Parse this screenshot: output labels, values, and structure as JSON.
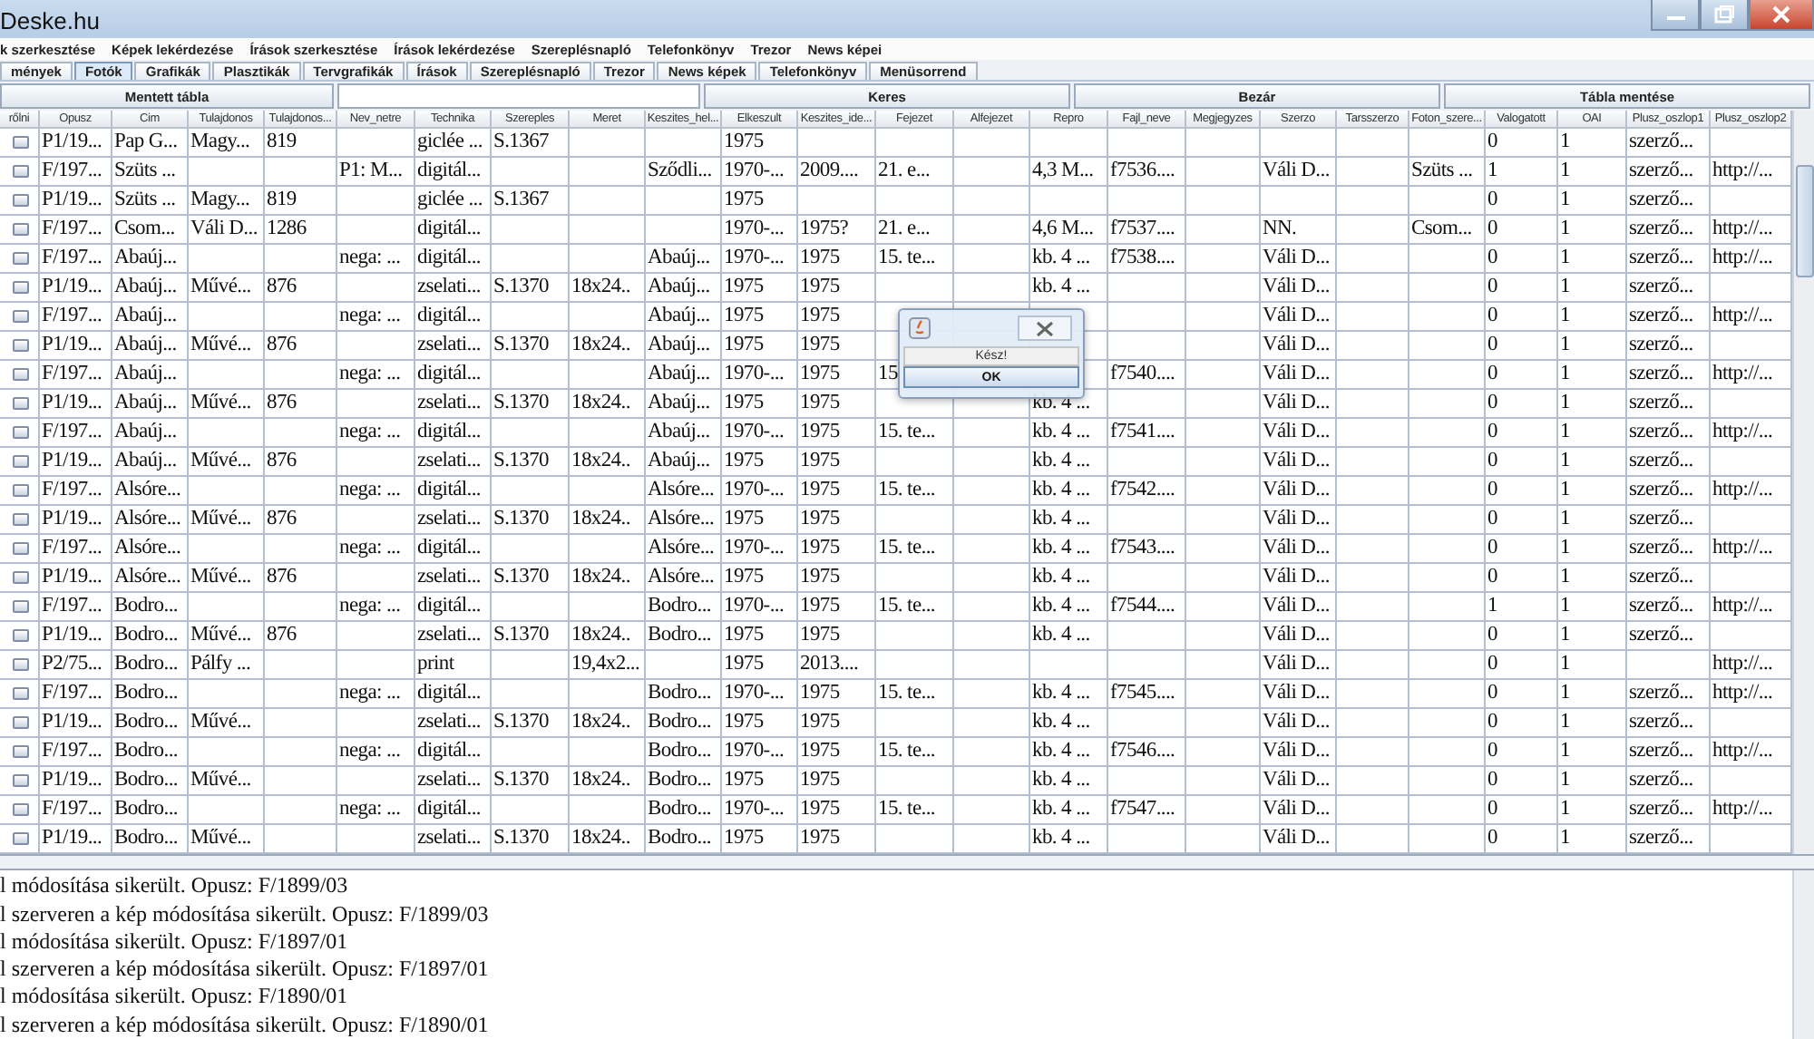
{
  "browser": {
    "title": "Deske.hu"
  },
  "menu": [
    "k szerkesztése",
    "Képek lekérdezése",
    "Írások szerkesztése",
    "Írások lekérdezése",
    "Szereplésnapló",
    "Telefonkönyv",
    "Trezor",
    "News képei"
  ],
  "tabs": [
    {
      "label": "mények",
      "selected": false
    },
    {
      "label": "Fotók",
      "selected": true
    },
    {
      "label": "Grafikák",
      "selected": false
    },
    {
      "label": "Plasztikák",
      "selected": false
    },
    {
      "label": "Tervgrafikák",
      "selected": false
    },
    {
      "label": "Írások",
      "selected": false
    },
    {
      "label": "Szereplésnapló",
      "selected": false
    },
    {
      "label": "Trezor",
      "selected": false
    },
    {
      "label": "News képek",
      "selected": false
    },
    {
      "label": "Telefonkönyv",
      "selected": false
    },
    {
      "label": "Menüsorrend",
      "selected": false
    }
  ],
  "toolbar": [
    {
      "kind": "button",
      "label": "Mentett tábla"
    },
    {
      "kind": "field"
    },
    {
      "kind": "button",
      "label": "Keres"
    },
    {
      "kind": "button",
      "label": "Bezár"
    },
    {
      "kind": "button",
      "label": "Tábla mentése"
    }
  ],
  "table": {
    "row_header_label": "rőlni",
    "columns": [
      "Opusz",
      "Cim",
      "Tulajdonos",
      "Tulajdonos...",
      "Nev_netre",
      "Technika",
      "Szereples",
      "Meret",
      "Keszites_hel...",
      "Elkeszult",
      "Keszites_ide...",
      "Fejezet",
      "Alfejezet",
      "Repro",
      "Fajl_neve",
      "Megjegyzes",
      "Szerzo",
      "Tarsszerzo",
      "Foton_szere...",
      "Valogatott",
      "OAI",
      "Plusz_oszlop1",
      "Plusz_oszlop2"
    ],
    "rows": [
      [
        "P1/19...",
        "Pap G...",
        "Magy...",
        "819",
        null,
        "giclée ...",
        "S.1367",
        null,
        null,
        "1975",
        null,
        null,
        null,
        null,
        null,
        null,
        null,
        null,
        null,
        "0",
        "1",
        "szerző...",
        null
      ],
      [
        "F/197...",
        "Szüts ...",
        null,
        null,
        "P1: M...",
        "digitál...",
        null,
        null,
        "Sződli...",
        "1970-...",
        "2009....",
        "21. e...",
        null,
        "4,3 M...",
        "f7536....",
        null,
        "Váli D...",
        null,
        "Szüts ...",
        "1",
        "1",
        "szerző...",
        "http://..."
      ],
      [
        "P1/19...",
        "Szüts ...",
        "Magy...",
        "819",
        null,
        "giclée ...",
        "S.1367",
        null,
        null,
        "1975",
        null,
        null,
        null,
        null,
        null,
        null,
        null,
        null,
        null,
        "0",
        "1",
        "szerző...",
        null
      ],
      [
        "F/197...",
        "Csom...",
        "Váli D...",
        "1286",
        null,
        "digitál...",
        null,
        null,
        null,
        "1970-...",
        "1975?",
        "21. e...",
        null,
        "4,6 M...",
        "f7537....",
        null,
        "NN.",
        null,
        "Csom...",
        "0",
        "1",
        "szerző...",
        "http://..."
      ],
      [
        "F/197...",
        "Abaúj...",
        null,
        null,
        "nega: ...",
        "digitál...",
        null,
        null,
        "Abaúj...",
        "1970-...",
        "1975",
        "15. te...",
        null,
        "kb. 4 ...",
        "f7538....",
        null,
        "Váli D...",
        null,
        null,
        "0",
        "1",
        "szerző...",
        "http://..."
      ],
      [
        "P1/19...",
        "Abaúj...",
        "Művé...",
        "876",
        null,
        "zselati...",
        "S.1370",
        "18x24..",
        "Abaúj...",
        "1975",
        "1975",
        null,
        null,
        "kb. 4 ...",
        null,
        null,
        "Váli D...",
        null,
        null,
        "0",
        "1",
        "szerző...",
        null
      ],
      [
        "F/197...",
        "Abaúj...",
        null,
        null,
        "nega: ...",
        "digitál...",
        null,
        null,
        "Abaúj...",
        "1975",
        "1975",
        null,
        null,
        null,
        null,
        null,
        "Váli D...",
        null,
        null,
        "0",
        "1",
        "szerző...",
        "http://..."
      ],
      [
        "P1/19...",
        "Abaúj...",
        "Művé...",
        "876",
        null,
        "zselati...",
        "S.1370",
        "18x24..",
        "Abaúj...",
        "1975",
        "1975",
        null,
        null,
        null,
        null,
        null,
        "Váli D...",
        null,
        null,
        "0",
        "1",
        "szerző...",
        null
      ],
      [
        "F/197...",
        "Abaúj...",
        null,
        null,
        "nega: ...",
        "digitál...",
        null,
        null,
        "Abaúj...",
        "1970-...",
        "1975",
        "15",
        null,
        null,
        "f7540....",
        null,
        "Váli D...",
        null,
        null,
        "0",
        "1",
        "szerző...",
        "http://..."
      ],
      [
        "P1/19...",
        "Abaúj...",
        "Művé...",
        "876",
        null,
        "zselati...",
        "S.1370",
        "18x24..",
        "Abaúj...",
        "1975",
        "1975",
        null,
        null,
        "kb. 4 ...",
        null,
        null,
        "Váli D...",
        null,
        null,
        "0",
        "1",
        "szerző...",
        null
      ],
      [
        "F/197...",
        "Abaúj...",
        null,
        null,
        "nega: ...",
        "digitál...",
        null,
        null,
        "Abaúj...",
        "1970-...",
        "1975",
        "15. te...",
        null,
        "kb. 4 ...",
        "f7541....",
        null,
        "Váli D...",
        null,
        null,
        "0",
        "1",
        "szerző...",
        "http://..."
      ],
      [
        "P1/19...",
        "Abaúj...",
        "Művé...",
        "876",
        null,
        "zselati...",
        "S.1370",
        "18x24..",
        "Abaúj...",
        "1975",
        "1975",
        null,
        null,
        "kb. 4 ...",
        null,
        null,
        "Váli D...",
        null,
        null,
        "0",
        "1",
        "szerző...",
        null
      ],
      [
        "F/197...",
        "Alsóre...",
        null,
        null,
        "nega: ...",
        "digitál...",
        null,
        null,
        "Alsóre...",
        "1970-...",
        "1975",
        "15. te...",
        null,
        "kb. 4 ...",
        "f7542....",
        null,
        "Váli D...",
        null,
        null,
        "0",
        "1",
        "szerző...",
        "http://..."
      ],
      [
        "P1/19...",
        "Alsóre...",
        "Művé...",
        "876",
        null,
        "zselati...",
        "S.1370",
        "18x24..",
        "Alsóre...",
        "1975",
        "1975",
        null,
        null,
        "kb. 4 ...",
        null,
        null,
        "Váli D...",
        null,
        null,
        "0",
        "1",
        "szerző...",
        null
      ],
      [
        "F/197...",
        "Alsóre...",
        null,
        null,
        "nega: ...",
        "digitál...",
        null,
        null,
        "Alsóre...",
        "1970-...",
        "1975",
        "15. te...",
        null,
        "kb. 4 ...",
        "f7543....",
        null,
        "Váli D...",
        null,
        null,
        "0",
        "1",
        "szerző...",
        "http://..."
      ],
      [
        "P1/19...",
        "Alsóre...",
        "Művé...",
        "876",
        null,
        "zselati...",
        "S.1370",
        "18x24..",
        "Alsóre...",
        "1975",
        "1975",
        null,
        null,
        "kb. 4 ...",
        null,
        null,
        "Váli D...",
        null,
        null,
        "0",
        "1",
        "szerző...",
        null
      ],
      [
        "F/197...",
        "Bodro...",
        null,
        null,
        "nega: ...",
        "digitál...",
        null,
        null,
        "Bodro...",
        "1970-...",
        "1975",
        "15. te...",
        null,
        "kb. 4 ...",
        "f7544....",
        null,
        "Váli D...",
        null,
        null,
        "1",
        "1",
        "szerző...",
        "http://..."
      ],
      [
        "P1/19...",
        "Bodro...",
        "Művé...",
        "876",
        null,
        "zselati...",
        "S.1370",
        "18x24..",
        "Bodro...",
        "1975",
        "1975",
        null,
        null,
        "kb. 4 ...",
        null,
        null,
        "Váli D...",
        null,
        null,
        "0",
        "1",
        "szerző...",
        null
      ],
      [
        "P2/75...",
        "Bodro...",
        "Pálfy ...",
        null,
        null,
        "print",
        null,
        "19,4x2...",
        null,
        "1975",
        "2013....",
        null,
        null,
        null,
        null,
        null,
        "Váli D...",
        null,
        null,
        "0",
        "1",
        null,
        "http://..."
      ],
      [
        "F/197...",
        "Bodro...",
        null,
        null,
        "nega: ...",
        "digitál...",
        null,
        null,
        "Bodro...",
        "1970-...",
        "1975",
        "15. te...",
        null,
        "kb. 4 ...",
        "f7545....",
        null,
        "Váli D...",
        null,
        null,
        "0",
        "1",
        "szerző...",
        "http://..."
      ],
      [
        "P1/19...",
        "Bodro...",
        "Művé...",
        null,
        null,
        "zselati...",
        "S.1370",
        "18x24..",
        "Bodro...",
        "1975",
        "1975",
        null,
        null,
        "kb. 4 ...",
        null,
        null,
        "Váli D...",
        null,
        null,
        "0",
        "1",
        "szerző...",
        null
      ],
      [
        "F/197...",
        "Bodro...",
        null,
        null,
        "nega: ...",
        "digitál...",
        null,
        null,
        "Bodro...",
        "1970-...",
        "1975",
        "15. te...",
        null,
        "kb. 4 ...",
        "f7546....",
        null,
        "Váli D...",
        null,
        null,
        "0",
        "1",
        "szerző...",
        "http://..."
      ],
      [
        "P1/19...",
        "Bodro...",
        "Művé...",
        null,
        null,
        "zselati...",
        "S.1370",
        "18x24..",
        "Bodro...",
        "1975",
        "1975",
        null,
        null,
        "kb. 4 ...",
        null,
        null,
        "Váli D...",
        null,
        null,
        "0",
        "1",
        "szerző...",
        null
      ],
      [
        "F/197...",
        "Bodro...",
        null,
        null,
        "nega: ...",
        "digitál...",
        null,
        null,
        "Bodro...",
        "1970-...",
        "1975",
        "15. te...",
        null,
        "kb. 4 ...",
        "f7547....",
        null,
        "Váli D...",
        null,
        null,
        "0",
        "1",
        "szerző...",
        "http://..."
      ],
      [
        "P1/19...",
        "Bodro...",
        "Művé...",
        null,
        null,
        "zselati...",
        "S.1370",
        "18x24..",
        "Bodro...",
        "1975",
        "1975",
        null,
        null,
        "kb. 4 ...",
        null,
        null,
        "Váli D...",
        null,
        null,
        "0",
        "1",
        "szerző...",
        null
      ]
    ]
  },
  "dialog": {
    "message": "Kész!",
    "button": "OK"
  },
  "log": [
    "l módosítása sikerült. Opusz: F/1899/03",
    "l szerveren a kép módosítása sikerült. Opusz: F/1899/03",
    "l módosítása sikerült. Opusz: F/1897/01",
    "l szerveren a kép módosítása sikerült. Opusz: F/1897/01",
    "l módosítása sikerült. Opusz: F/1890/01",
    "l szerveren a kép módosítása sikerült. Opusz: F/1890/01"
  ]
}
